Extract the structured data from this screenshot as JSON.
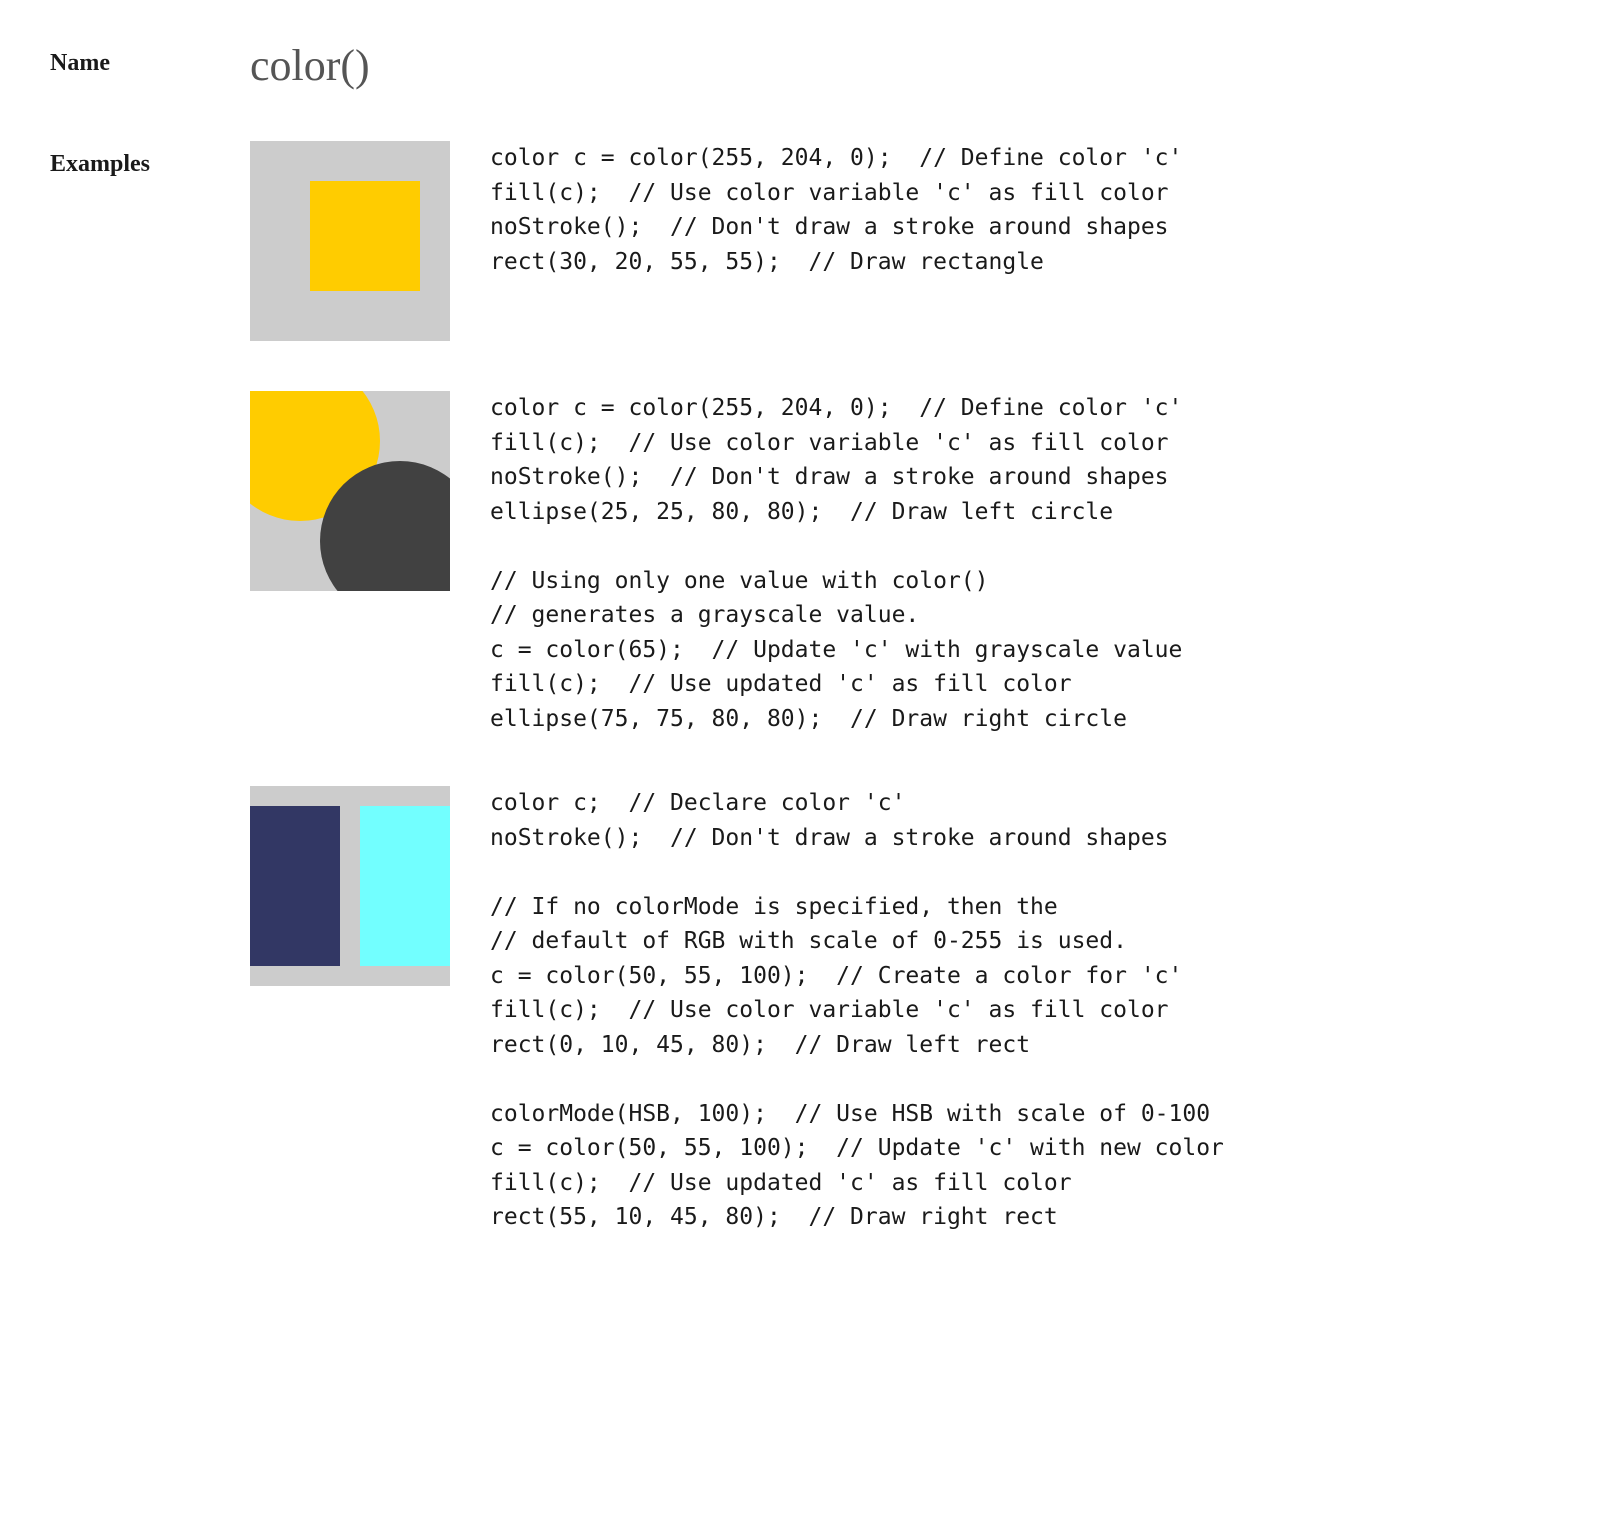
{
  "labels": {
    "name": "Name",
    "examples": "Examples"
  },
  "title": "color()",
  "examples": [
    {
      "code": "color c = color(255, 204, 0);  // Define color 'c'\nfill(c);  // Use color variable 'c' as fill color\nnoStroke();  // Don't draw a stroke around shapes\nrect(30, 20, 55, 55);  // Draw rectangle"
    },
    {
      "code": "color c = color(255, 204, 0);  // Define color 'c'\nfill(c);  // Use color variable 'c' as fill color\nnoStroke();  // Don't draw a stroke around shapes\nellipse(25, 25, 80, 80);  // Draw left circle\n\n// Using only one value with color()\n// generates a grayscale value.\nc = color(65);  // Update 'c' with grayscale value\nfill(c);  // Use updated 'c' as fill color\nellipse(75, 75, 80, 80);  // Draw right circle"
    },
    {
      "code": "color c;  // Declare color 'c'\nnoStroke();  // Don't draw a stroke around shapes\n\n// If no colorMode is specified, then the\n// default of RGB with scale of 0-255 is used.\nc = color(50, 55, 100);  // Create a color for 'c'\nfill(c);  // Use color variable 'c' as fill color\nrect(0, 10, 45, 80);  // Draw left rect\n\ncolorMode(HSB, 100);  // Use HSB with scale of 0-100\nc = color(50, 55, 100);  // Update 'c' with new color\nfill(c);  // Use updated 'c' as fill color\nrect(55, 10, 45, 80);  // Draw right rect"
    }
  ],
  "colors": {
    "bg": "#cccccc",
    "yellow": "#ffcc00",
    "gray65": "#414141",
    "navy": "#323764",
    "cyan": "#72ffff"
  }
}
